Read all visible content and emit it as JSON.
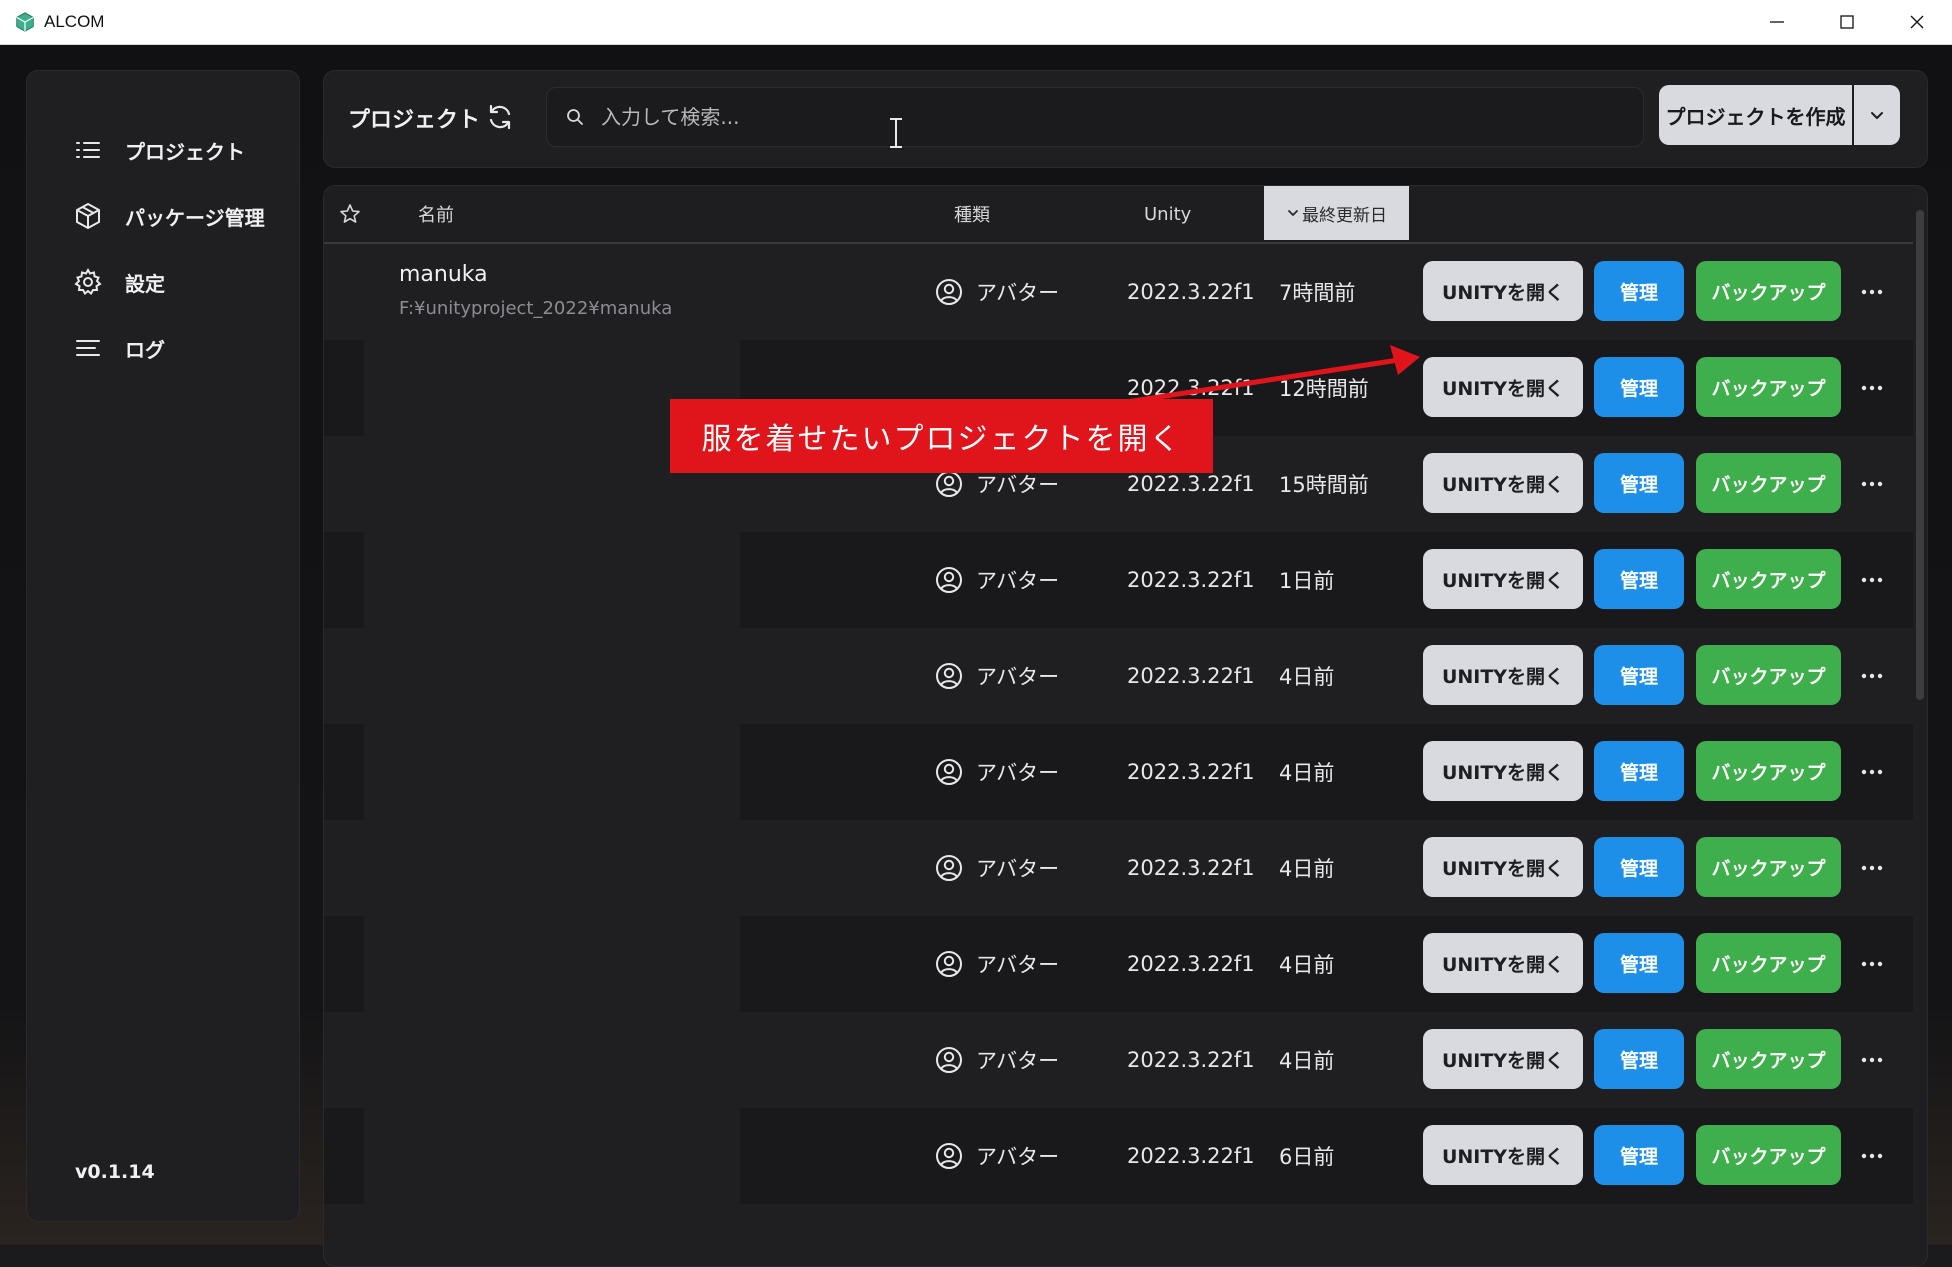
{
  "window": {
    "title": "ALCOM"
  },
  "sidebar": {
    "items": [
      {
        "label": "プロジェクト",
        "icon": "list-icon"
      },
      {
        "label": "パッケージ管理",
        "icon": "package-icon"
      },
      {
        "label": "設定",
        "icon": "gear-icon"
      },
      {
        "label": "ログ",
        "icon": "lines-icon"
      }
    ],
    "version": "v0.1.14"
  },
  "header": {
    "title": "プロジェクト",
    "search_placeholder": "入力して検索...",
    "create_label": "プロジェクトを作成"
  },
  "table": {
    "columns": {
      "name": "名前",
      "type": "種類",
      "unity": "Unity",
      "updated": "最終更新日"
    },
    "sorted_column": "最終更新日",
    "buttons": {
      "open": "UNITYを開く",
      "manage": "管理",
      "backup": "バックアップ"
    },
    "rows": [
      {
        "name": "manuka",
        "path": "F:¥unityproject_2022¥manuka",
        "type": "アバター",
        "unity": "2022.3.22f1",
        "updated": "7時間前"
      },
      {
        "name": "",
        "path": "",
        "type": "",
        "unity": "2022.3.22f1",
        "updated": "12時間前"
      },
      {
        "name": "",
        "path": "",
        "type": "アバター",
        "unity": "2022.3.22f1",
        "updated": "15時間前"
      },
      {
        "name": "",
        "path": "",
        "type": "アバター",
        "unity": "2022.3.22f1",
        "updated": "1日前"
      },
      {
        "name": "",
        "path": "",
        "type": "アバター",
        "unity": "2022.3.22f1",
        "updated": "4日前"
      },
      {
        "name": "",
        "path": "",
        "type": "アバター",
        "unity": "2022.3.22f1",
        "updated": "4日前"
      },
      {
        "name": "",
        "path": "",
        "type": "アバター",
        "unity": "2022.3.22f1",
        "updated": "4日前"
      },
      {
        "name": "",
        "path": "",
        "type": "アバター",
        "unity": "2022.3.22f1",
        "updated": "4日前"
      },
      {
        "name": "",
        "path": "",
        "type": "アバター",
        "unity": "2022.3.22f1",
        "updated": "4日前"
      },
      {
        "name": "",
        "path": "",
        "type": "アバター",
        "unity": "2022.3.22f1",
        "updated": "6日前"
      }
    ]
  },
  "annotation": {
    "text": "服を着せたいプロジェクトを開く",
    "color": "#e0151b"
  },
  "colors": {
    "manage": "#1e8fe8",
    "backup": "#3fae4c",
    "open": "#d9dadf"
  }
}
